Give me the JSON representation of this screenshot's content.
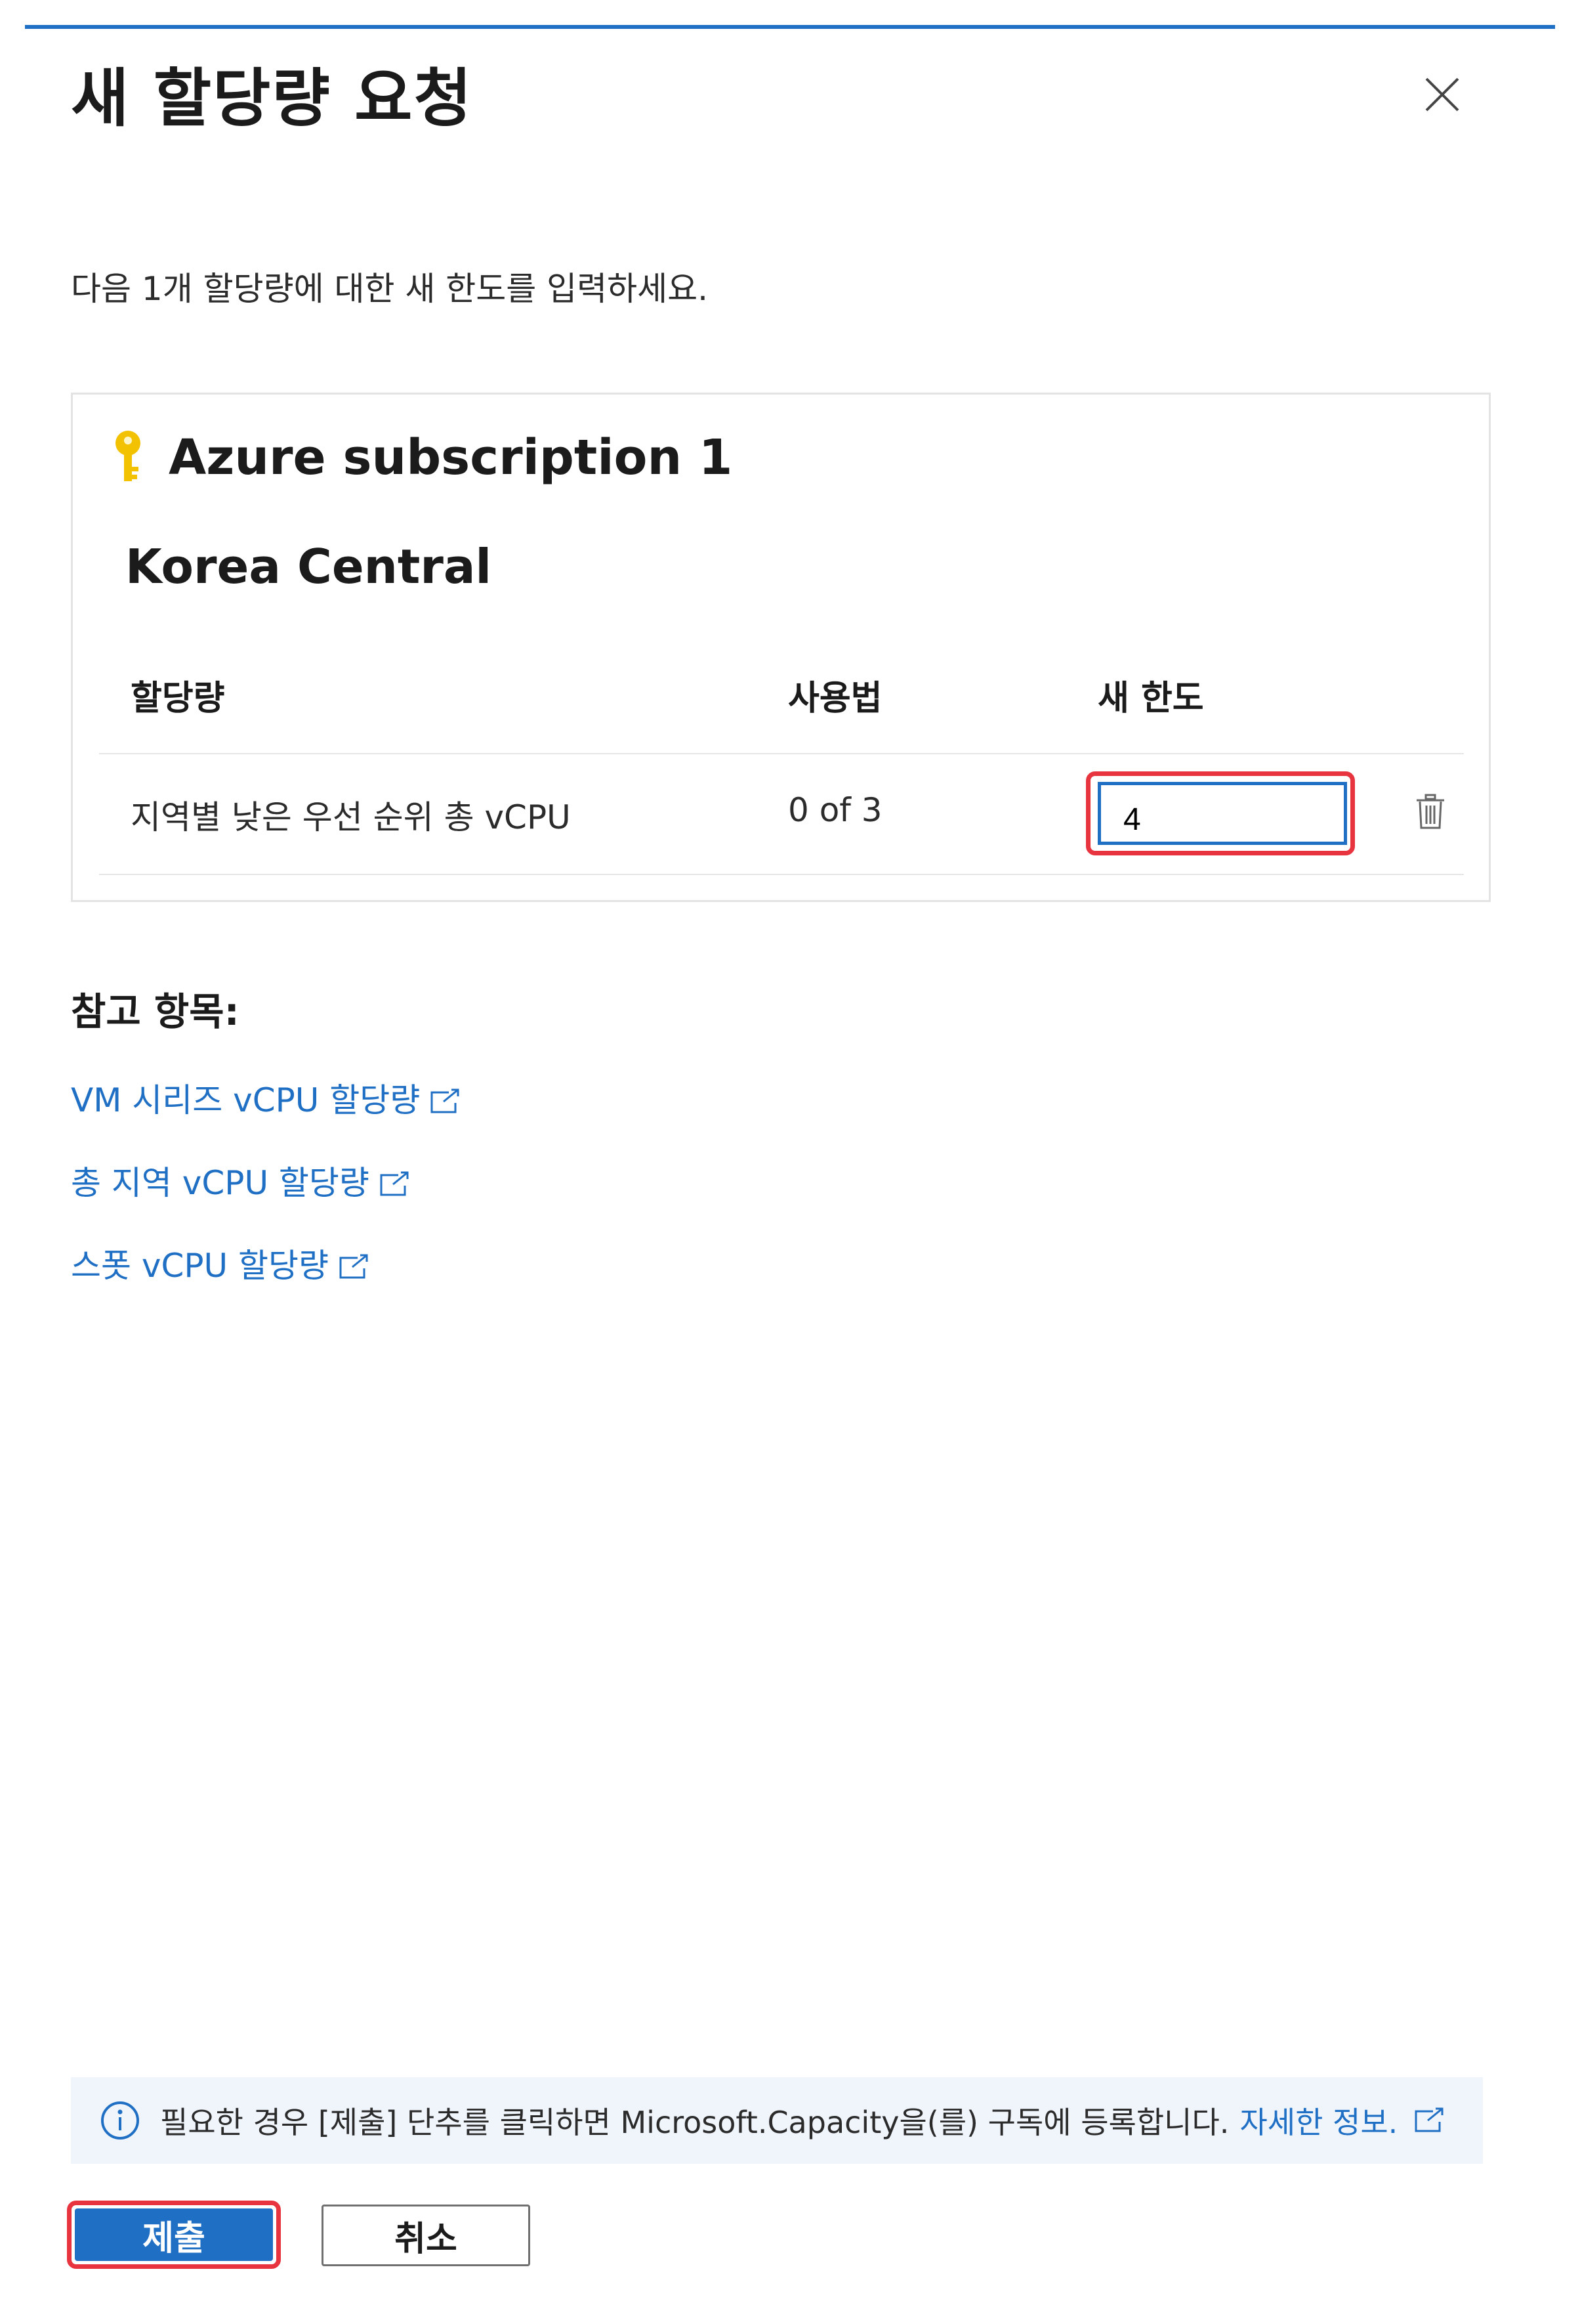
{
  "dialog": {
    "title": "새 할당량 요청",
    "instruction": "다음 1개 할당량에 대한 새 한도를 입력하세요."
  },
  "subscription": {
    "name": "Azure subscription 1",
    "icon": "key-icon",
    "region": "Korea Central"
  },
  "table": {
    "headers": {
      "quota": "할당량",
      "usage": "사용법",
      "new_limit": "새 한도"
    },
    "rows": [
      {
        "quota": "지역별 낮은 우선 순위 총 vCPU",
        "usage": "0 of 3",
        "new_limit": "4"
      }
    ]
  },
  "references": {
    "heading": "참고 항목:",
    "links": [
      {
        "label": "VM 시리즈 vCPU 할당량",
        "icon": "external-link-icon"
      },
      {
        "label": "총 지역 vCPU 할당량",
        "icon": "external-link-icon"
      },
      {
        "label": "스폿 vCPU 할당량",
        "icon": "external-link-icon"
      }
    ]
  },
  "info_bar": {
    "text": "필요한 경우 [제출] 단추를 클릭하면 Microsoft.Capacity을(를) 구독에 등록합니다.",
    "link_label": "자세한 정보.",
    "icon": "info-icon"
  },
  "footer": {
    "submit_label": "제출",
    "cancel_label": "취소"
  },
  "colors": {
    "accent": "#1f6fc4",
    "highlight": "#e8343f",
    "info_background": "#f0f5fc",
    "key_icon": "#f2c200"
  }
}
